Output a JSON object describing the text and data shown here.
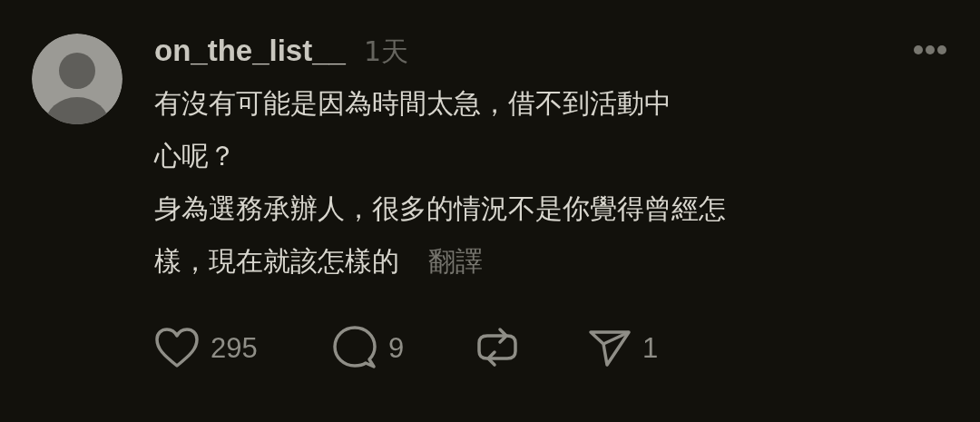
{
  "comment": {
    "username": "on_the_list__",
    "time": "1天",
    "lines": [
      "有沒有可能是因為時間太急，借不到活動中",
      "心呢？",
      "身為選務承辦人，很多的情況不是你覺得曾經怎",
      "樣，現在就該怎樣的"
    ],
    "translate_link": "翻譯",
    "actions": [
      {
        "kind": "like",
        "count": "295"
      },
      {
        "kind": "reply",
        "count": "9"
      },
      {
        "kind": "repost"
      },
      {
        "kind": "share",
        "count": "1"
      }
    ]
  }
}
